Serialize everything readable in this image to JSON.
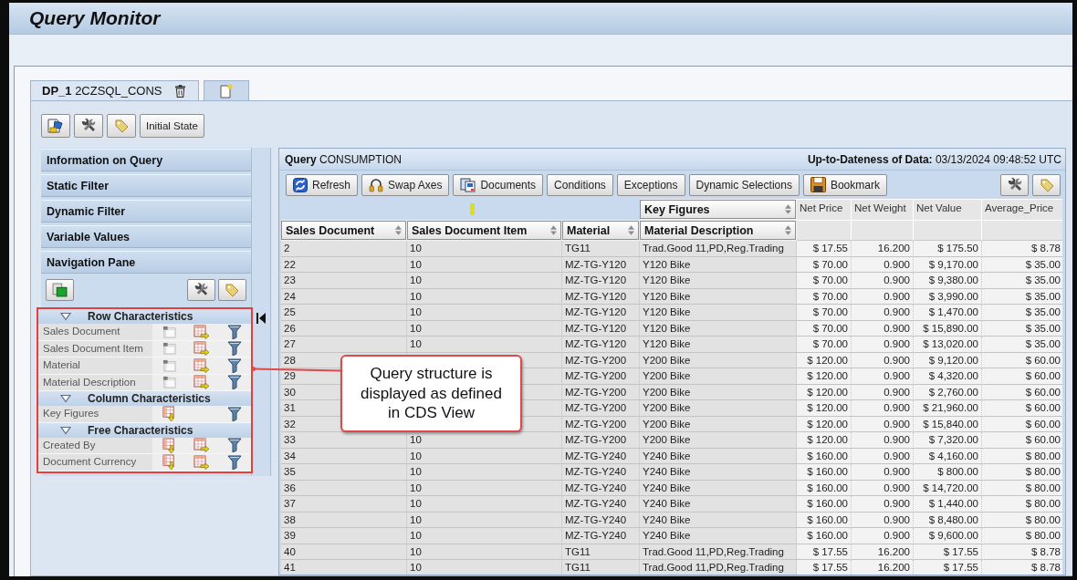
{
  "window": {
    "title": "Query Monitor"
  },
  "tabs": [
    {
      "kind": "query",
      "label": "**DP_1** 2CZSQL_CONS",
      "selected": true
    },
    {
      "kind": "new",
      "selected": false
    }
  ],
  "toolbar": {
    "text_button": "Initial State"
  },
  "sidebar": {
    "sections": [
      "Information on Query",
      "Static Filter",
      "Dynamic Filter",
      "Variable Values",
      "Navigation Pane"
    ],
    "navigation": {
      "groups": [
        {
          "title": "Row Characteristics",
          "kind": "rows",
          "expanded": true,
          "items": [
            "Sales Document",
            "Sales Document Item",
            "Material",
            "Material Description"
          ]
        },
        {
          "title": "Column Characteristics",
          "kind": "columns",
          "expanded": true,
          "items": [
            "Key Figures"
          ]
        },
        {
          "title": "Free Characteristics",
          "kind": "free",
          "expanded": true,
          "items": [
            "Created By",
            "Document Currency"
          ]
        }
      ]
    }
  },
  "query": {
    "title": "**Query** CONSUMPTION",
    "freshness": "**Up-to-Dateness of Data:** 03/13/2024 09:48:52 UTC",
    "toolbar": [
      {
        "label": "Refresh",
        "kind": "refresh"
      },
      {
        "label": "Swap Axes",
        "kind": "swap"
      },
      {
        "label": "Documents",
        "kind": "documents"
      },
      {
        "label": "Conditions",
        "kind": "text"
      },
      {
        "label": "Exceptions",
        "kind": "text"
      },
      {
        "label": "Dynamic Selections",
        "kind": "text"
      },
      {
        "label": "Bookmark",
        "kind": "bookmark"
      }
    ],
    "table": {
      "structure_header": "Key Figures",
      "columns": [
        {
          "label": "Sales Document",
          "kind": "characteristic"
        },
        {
          "label": "Sales Document Item",
          "kind": "characteristic"
        },
        {
          "label": "Material",
          "kind": "characteristic"
        },
        {
          "label": "Material Description",
          "kind": "characteristic"
        },
        {
          "label": "Net Price",
          "kind": "key_figure"
        },
        {
          "label": "Net Weight",
          "kind": "key_figure"
        },
        {
          "label": "Net Value",
          "kind": "key_figure"
        },
        {
          "label": "Average_Price",
          "kind": "key_figure"
        }
      ],
      "rows": [
        [
          "2",
          "10",
          "TG11",
          "Trad.Good 11,PD,Reg.Trading",
          "$ 17.55",
          "16.200",
          "$ 175.50",
          "$ 8.78"
        ],
        [
          "22",
          "10",
          "MZ-TG-Y120",
          "Y120 Bike",
          "$ 70.00",
          "0.900",
          "$ 9,170.00",
          "$ 35.00"
        ],
        [
          "23",
          "10",
          "MZ-TG-Y120",
          "Y120 Bike",
          "$ 70.00",
          "0.900",
          "$ 9,380.00",
          "$ 35.00"
        ],
        [
          "24",
          "10",
          "MZ-TG-Y120",
          "Y120 Bike",
          "$ 70.00",
          "0.900",
          "$ 3,990.00",
          "$ 35.00"
        ],
        [
          "25",
          "10",
          "MZ-TG-Y120",
          "Y120 Bike",
          "$ 70.00",
          "0.900",
          "$ 1,470.00",
          "$ 35.00"
        ],
        [
          "26",
          "10",
          "MZ-TG-Y120",
          "Y120 Bike",
          "$ 70.00",
          "0.900",
          "$ 15,890.00",
          "$ 35.00"
        ],
        [
          "27",
          "10",
          "MZ-TG-Y120",
          "Y120 Bike",
          "$ 70.00",
          "0.900",
          "$ 13,020.00",
          "$ 35.00"
        ],
        [
          "28",
          null,
          "MZ-TG-Y200",
          "Y200 Bike",
          "$ 120.00",
          "0.900",
          "$ 9,120.00",
          "$ 60.00"
        ],
        [
          "29",
          null,
          "MZ-TG-Y200",
          "Y200 Bike",
          "$ 120.00",
          "0.900",
          "$ 4,320.00",
          "$ 60.00"
        ],
        [
          "30",
          null,
          "MZ-TG-Y200",
          "Y200 Bike",
          "$ 120.00",
          "0.900",
          "$ 2,760.00",
          "$ 60.00"
        ],
        [
          "31",
          null,
          "MZ-TG-Y200",
          "Y200 Bike",
          "$ 120.00",
          "0.900",
          "$ 21,960.00",
          "$ 60.00"
        ],
        [
          "32",
          null,
          "MZ-TG-Y200",
          "Y200 Bike",
          "$ 120.00",
          "0.900",
          "$ 15,840.00",
          "$ 60.00"
        ],
        [
          "33",
          "10",
          "MZ-TG-Y200",
          "Y200 Bike",
          "$ 120.00",
          "0.900",
          "$ 7,320.00",
          "$ 60.00"
        ],
        [
          "34",
          "10",
          "MZ-TG-Y240",
          "Y240 Bike",
          "$ 160.00",
          "0.900",
          "$ 4,160.00",
          "$ 80.00"
        ],
        [
          "35",
          "10",
          "MZ-TG-Y240",
          "Y240 Bike",
          "$ 160.00",
          "0.900",
          "$ 800.00",
          "$ 80.00"
        ],
        [
          "36",
          "10",
          "MZ-TG-Y240",
          "Y240 Bike",
          "$ 160.00",
          "0.900",
          "$ 14,720.00",
          "$ 80.00"
        ],
        [
          "37",
          "10",
          "MZ-TG-Y240",
          "Y240 Bike",
          "$ 160.00",
          "0.900",
          "$ 1,440.00",
          "$ 80.00"
        ],
        [
          "38",
          "10",
          "MZ-TG-Y240",
          "Y240 Bike",
          "$ 160.00",
          "0.900",
          "$ 8,480.00",
          "$ 80.00"
        ],
        [
          "39",
          "10",
          "MZ-TG-Y240",
          "Y240 Bike",
          "$ 160.00",
          "0.900",
          "$ 9,600.00",
          "$ 80.00"
        ],
        [
          "40",
          "10",
          "TG11",
          "Trad.Good 11,PD,Reg.Trading",
          "$ 17.55",
          "16.200",
          "$ 17.55",
          "$ 8.78"
        ],
        [
          "41",
          "10",
          "TG11",
          "Trad.Good 11,PD,Reg.Trading",
          "$ 17.55",
          "16.200",
          "$ 17.55",
          "$ 8.78"
        ]
      ]
    }
  },
  "callout": {
    "lines": [
      "Query structure is",
      "displayed as defined",
      "in CDS View"
    ]
  }
}
